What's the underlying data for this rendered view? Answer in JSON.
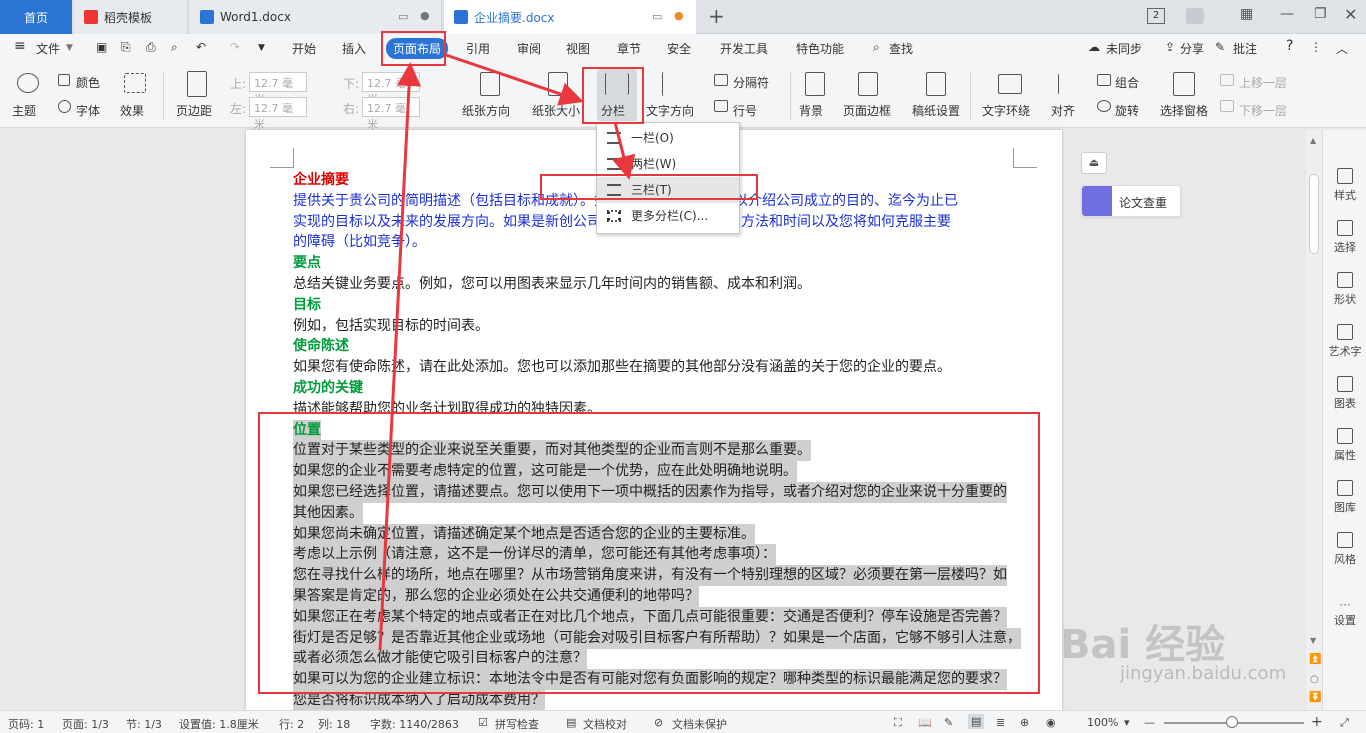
{
  "tabs": {
    "home": "首页",
    "tab1": "稻壳模板",
    "tab2": "Word1.docx",
    "tab3": "企业摘要.docx",
    "add": "+",
    "count": "2"
  },
  "menu": {
    "file": "文件",
    "start": "开始",
    "insert": "插入",
    "layout": "页面布局",
    "ref": "引用",
    "review": "审阅",
    "view": "视图",
    "chapter": "章节",
    "security": "安全",
    "dev": "开发工具",
    "special": "特色功能",
    "search": "查找",
    "sync": "未同步",
    "share": "分享",
    "comment": "批注",
    "help": "?"
  },
  "ribbon": {
    "theme": "主题",
    "color": "颜色",
    "font": "字体",
    "effect": "效果",
    "margin": "页边距",
    "up": "上:",
    "down": "下:",
    "left": "左:",
    "right": "右:",
    "mm": "12.7 毫米",
    "orient": "纸张方向",
    "size": "纸张大小",
    "columns": "分栏",
    "textdir": "文字方向",
    "breaks": "分隔符",
    "linenum": "行号",
    "bg": "背景",
    "border": "页面边框",
    "paper": "稿纸设置",
    "wrap": "文字环绕",
    "align": "对齐",
    "group": "组合",
    "rotate": "旋转",
    "selpane": "选择窗格",
    "bringup": "上移一层",
    "senddown": "下移一层"
  },
  "dropdown": [
    "一栏(O)",
    "两栏(W)",
    "三栏(T)",
    "更多分栏(C)..."
  ],
  "doc": {
    "lines": [
      {
        "t": "企业摘要",
        "c": "red"
      },
      {
        "t": "提供关于贵公司的简明描述（包括目标和成就）。如果是现有公司，您可以介绍公司成立的目的、迄今为止已",
        "c": "blue"
      },
      {
        "t": "实现的目标以及未来的发展方向。如果是新创公司，请概述您实现计划的方法和时间以及您将如何克服主要",
        "c": "blue"
      },
      {
        "t": "的障碍（比如竞争）。",
        "c": "blue"
      },
      {
        "t": "要点",
        "c": "green"
      },
      {
        "t": "总结关键业务要点。例如，您可以用图表来显示几年时间内的销售额、成本和利润。",
        "c": ""
      },
      {
        "t": "目标",
        "c": "green"
      },
      {
        "t": "例如，包括实现目标的时间表。",
        "c": ""
      },
      {
        "t": "使命陈述",
        "c": "green"
      },
      {
        "t": "如果您有使命陈述，请在此处添加。您也可以添加那些在摘要的其他部分没有涵盖的关于您的企业的要点。",
        "c": ""
      },
      {
        "t": "成功的关键",
        "c": "green"
      },
      {
        "t": "描述能够帮助您的业务计划取得成功的独特因素。",
        "c": ""
      },
      {
        "t": "位置",
        "c": "green hl"
      },
      {
        "t": "位置对于某些类型的企业来说至关重要，而对其他类型的企业而言则不是那么重要。",
        "c": "hl"
      },
      {
        "t": "如果您的企业不需要考虑特定的位置，这可能是一个优势，应在此处明确地说明。",
        "c": "hl"
      },
      {
        "t": "如果您已经选择位置，请描述要点。您可以使用下一项中概括的因素作为指导，或者介绍对您的企业来说十分重要的",
        "c": "hl"
      },
      {
        "t": "其他因素。",
        "c": "hl"
      },
      {
        "t": "如果您尚未确定位置，请描述确定某个地点是否适合您的企业的主要标准。",
        "c": "hl"
      },
      {
        "t": "考虑以上示例（请注意，这不是一份详尽的清单，您可能还有其他考虑事项）：",
        "c": "hl"
      },
      {
        "t": "您在寻找什么样的场所，地点在哪里？从市场营销角度来讲，有没有一个特别理想的区域？必须要在第一层楼吗？如",
        "c": "hl"
      },
      {
        "t": "果答案是肯定的，那么您的企业必须处在公共交通便利的地带吗？",
        "c": "hl"
      },
      {
        "t": "如果您正在考虑某个特定的地点或者正在对比几个地点，下面几点可能很重要：交通是否便利？停车设施是否完善？",
        "c": "hl"
      },
      {
        "t": "街灯是否足够？是否靠近其他企业或场地（可能会对吸引目标客户有所帮助）？如果是一个店面，它够不够引人注意，",
        "c": "hl"
      },
      {
        "t": "或者必须怎么做才能使它吸引目标客户的注意？",
        "c": "hl"
      },
      {
        "t": "如果可以为您的企业建立标识：本地法令中是否有可能对您有负面影响的规定？哪种类型的标识最能满足您的要求？",
        "c": "hl"
      },
      {
        "t": "您是否将标识成本纳入了启动成本费用？",
        "c": "hl"
      }
    ]
  },
  "side": {
    "paper_check": "论文查重"
  },
  "rpanel": [
    "样式",
    "选择",
    "形状",
    "艺术字",
    "图表",
    "属性",
    "图库",
    "风格",
    "设置"
  ],
  "status": {
    "pagecode": "页码: 1",
    "page": "页面: 1/3",
    "section": "节: 1/3",
    "setting": "设置值: 1.8厘米",
    "row": "行: 2",
    "col": "列: 18",
    "words": "字数: 1140/2863",
    "spell": "拼写检查",
    "proof": "文档校对",
    "protect": "文档未保护",
    "zoom": "100%"
  },
  "watermark": {
    "brand": "Bai 经验",
    "url": "jingyan.baidu.com"
  },
  "colors": {
    "accent": "#2b74d4",
    "annotation": "#e8383d",
    "highlight": "#cfcfcf"
  }
}
